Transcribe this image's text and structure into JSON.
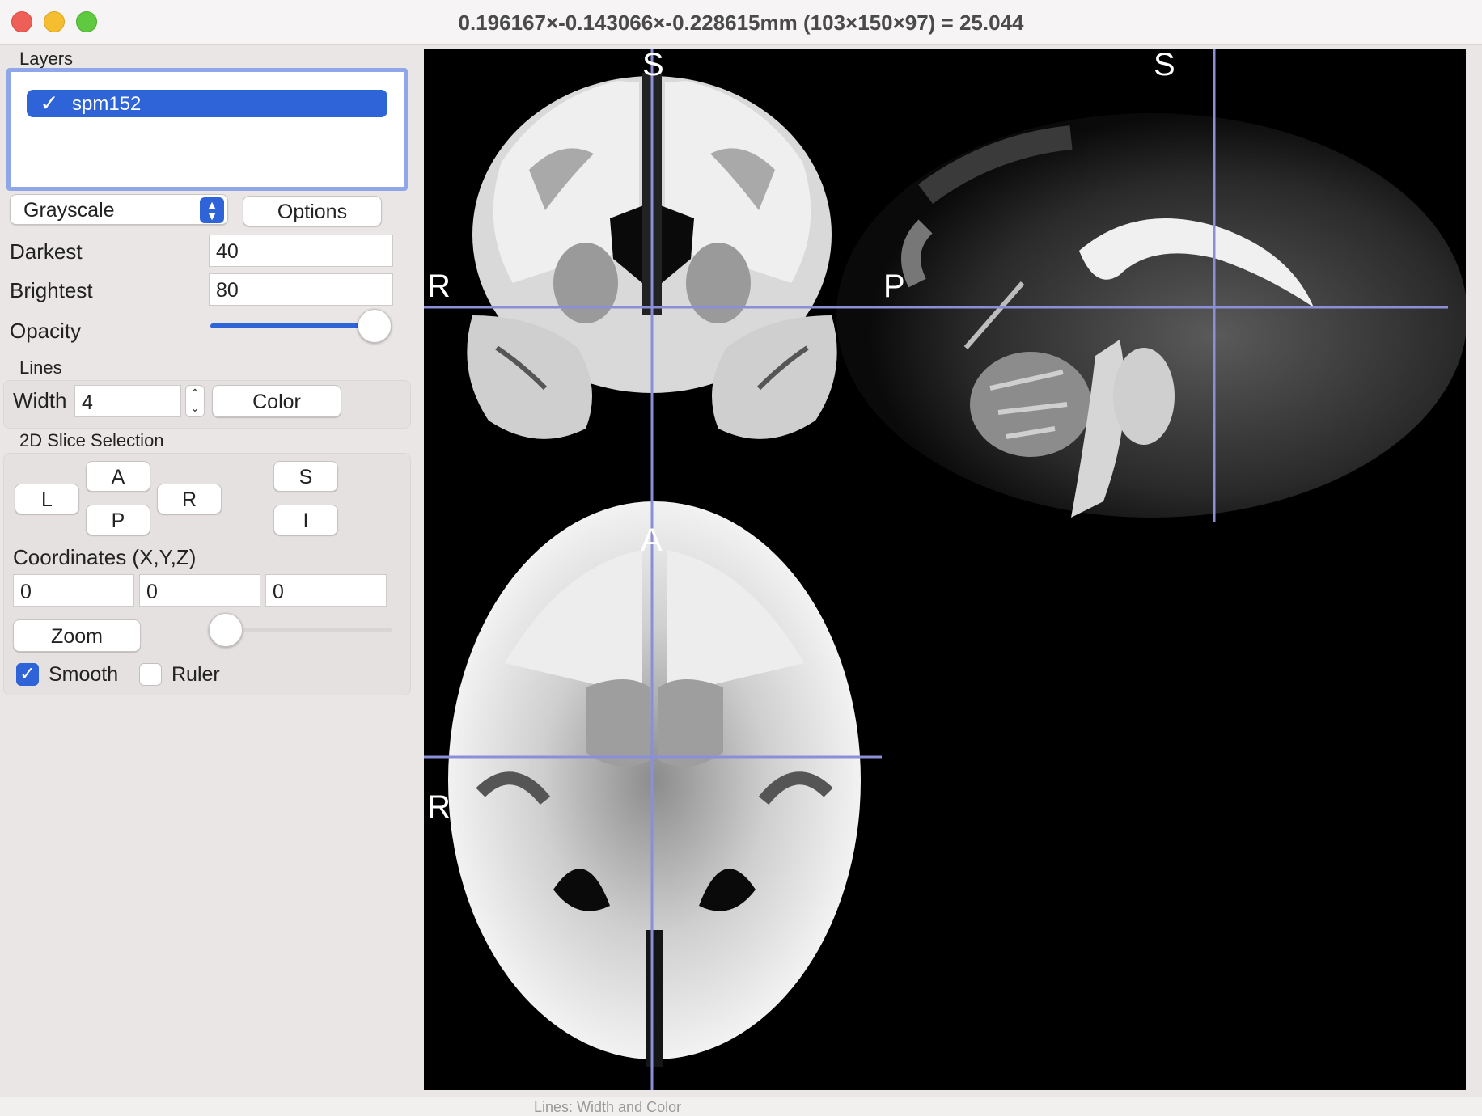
{
  "window": {
    "title": "0.196167×-0.143066×-0.228615mm (103×150×97) =  25.044"
  },
  "layers": {
    "label": "Layers",
    "items": [
      {
        "name": "spm152",
        "checked": true
      }
    ]
  },
  "display": {
    "colormap": "Grayscale",
    "options_label": "Options",
    "darkest_label": "Darkest",
    "darkest_value": "40",
    "brightest_label": "Brightest",
    "brightest_value": "80",
    "opacity_label": "Opacity",
    "opacity_fraction": 1.0
  },
  "lines": {
    "label": "Lines",
    "width_label": "Width",
    "width_value": "4",
    "color_label": "Color"
  },
  "slice_selection": {
    "label": "2D Slice Selection",
    "buttons": {
      "L": "L",
      "A": "A",
      "R": "R",
      "P": "P",
      "S": "S",
      "I": "I"
    },
    "coordinates_label": "Coordinates (X,Y,Z)",
    "x": "0",
    "y": "0",
    "z": "0",
    "zoom_label": "Zoom",
    "zoom_fraction": 0.0,
    "smooth_label": "Smooth",
    "smooth_checked": true,
    "ruler_label": "Ruler",
    "ruler_checked": false
  },
  "viewer": {
    "orientation_labels": {
      "coronal_top": "S",
      "coronal_left": "R",
      "sagittal_top": "S",
      "sagittal_left": "P",
      "axial_top": "A",
      "axial_left": "R"
    },
    "crosshair_color": "#8a8fd8"
  },
  "colors": {
    "accent": "#2f63d8",
    "panel_bg": "#ebe6e6",
    "viewer_bg": "#000000"
  },
  "status": {
    "text": "Lines: Width and Color"
  }
}
